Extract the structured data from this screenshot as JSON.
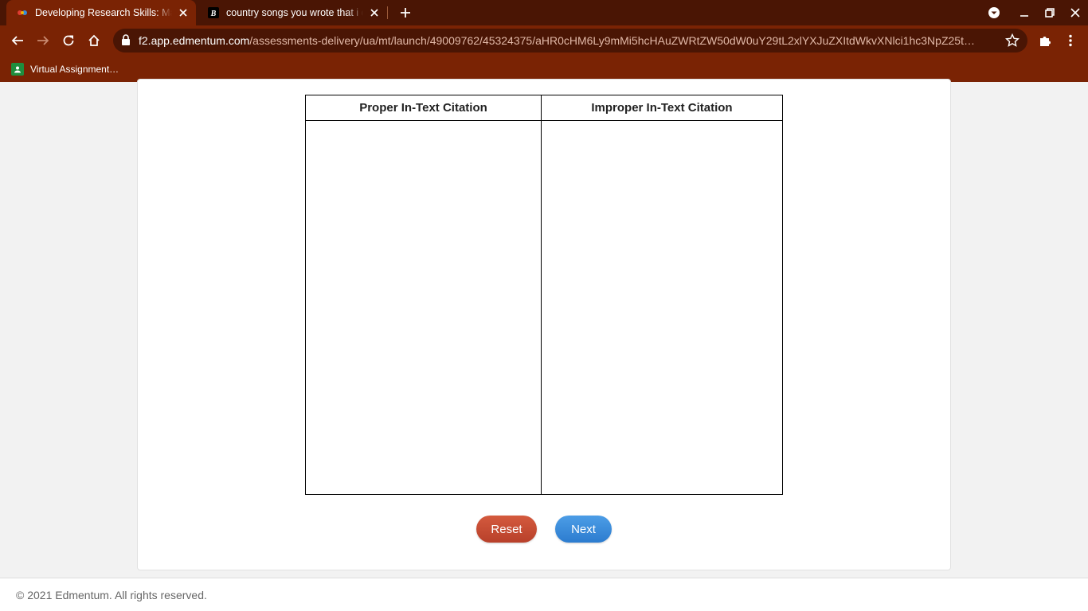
{
  "colors": {
    "tabstrip": "#4a1504",
    "toolbar": "#7a2304",
    "reset_button": "#c44a34",
    "next_button": "#3a8bd9"
  },
  "browser": {
    "tabs": [
      {
        "title": "Developing Research Skills: Mast",
        "icon": "edmentum-favicon-icon",
        "active": true
      },
      {
        "title": "country songs you wrote that i c",
        "icon": "brainly-favicon-icon",
        "active": false
      }
    ],
    "address": {
      "host": "f2.app.edmentum.com",
      "path": "/assessments-delivery/ua/mt/launch/49009762/45324375/aHR0cHM6Ly9mMi5hcHAuZWRtZW50dW0uY29tL2xlYXJuZXItdWkvXNlci1hc3NpZ25t…"
    },
    "bookmarks": [
      {
        "label": "Virtual Assignment…",
        "icon": "classroom-icon"
      }
    ]
  },
  "activity": {
    "columns": [
      {
        "header": "Proper In-Text Citation"
      },
      {
        "header": "Improper In-Text Citation"
      }
    ],
    "buttons": {
      "reset": "Reset",
      "next": "Next"
    }
  },
  "footer": {
    "copyright": "© 2021 Edmentum. All rights reserved."
  }
}
